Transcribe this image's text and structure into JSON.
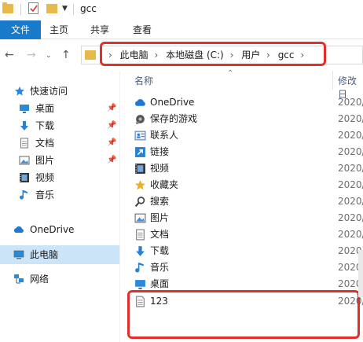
{
  "window": {
    "title": "gcc"
  },
  "ribbon": {
    "tabs": [
      "文件",
      "主页",
      "共享",
      "查看"
    ]
  },
  "address": {
    "crumbs": [
      "此电脑",
      "本地磁盘 (C:)",
      "用户",
      "gcc"
    ]
  },
  "nav": {
    "items": [
      {
        "label": "快速访问",
        "icon": "star-icon",
        "pinned": false
      },
      {
        "label": "桌面",
        "icon": "desktop-icon",
        "pinned": true
      },
      {
        "label": "下载",
        "icon": "download-icon",
        "pinned": true
      },
      {
        "label": "文档",
        "icon": "document-icon",
        "pinned": true
      },
      {
        "label": "图片",
        "icon": "picture-icon",
        "pinned": true
      },
      {
        "label": "视频",
        "icon": "video-icon",
        "pinned": false
      },
      {
        "label": "音乐",
        "icon": "music-icon",
        "pinned": false
      },
      {
        "label": "OneDrive",
        "icon": "onedrive-icon",
        "pinned": false
      },
      {
        "label": "此电脑",
        "icon": "computer-icon",
        "pinned": false,
        "selected": true
      },
      {
        "label": "网络",
        "icon": "network-icon",
        "pinned": false
      }
    ]
  },
  "columns": {
    "name": "名称",
    "modified": "修改日"
  },
  "files": [
    {
      "name": "OneDrive",
      "date": "2020/",
      "icon": "onedrive-icon"
    },
    {
      "name": "保存的游戏",
      "date": "2020/",
      "icon": "saved-games-icon"
    },
    {
      "name": "联系人",
      "date": "2020/",
      "icon": "contacts-icon"
    },
    {
      "name": "链接",
      "date": "2020/",
      "icon": "links-icon"
    },
    {
      "name": "视频",
      "date": "2020/",
      "icon": "video-icon"
    },
    {
      "name": "收藏夹",
      "date": "2020/",
      "icon": "favorites-icon"
    },
    {
      "name": "搜索",
      "date": "2020/",
      "icon": "search-icon"
    },
    {
      "name": "图片",
      "date": "2020/",
      "icon": "picture-icon"
    },
    {
      "name": "文档",
      "date": "2020/",
      "icon": "document-icon"
    },
    {
      "name": "下载",
      "date": "2020/",
      "icon": "download-icon"
    },
    {
      "name": "音乐",
      "date": "2020/",
      "icon": "music-icon"
    },
    {
      "name": "桌面",
      "date": "2020/",
      "icon": "desktop-icon"
    },
    {
      "name": "123",
      "date": "2020/",
      "icon": "text-file-icon"
    }
  ],
  "colors": {
    "accent": "#1979ca",
    "highlight": "#e0302b",
    "selected": "#cce4f7"
  }
}
